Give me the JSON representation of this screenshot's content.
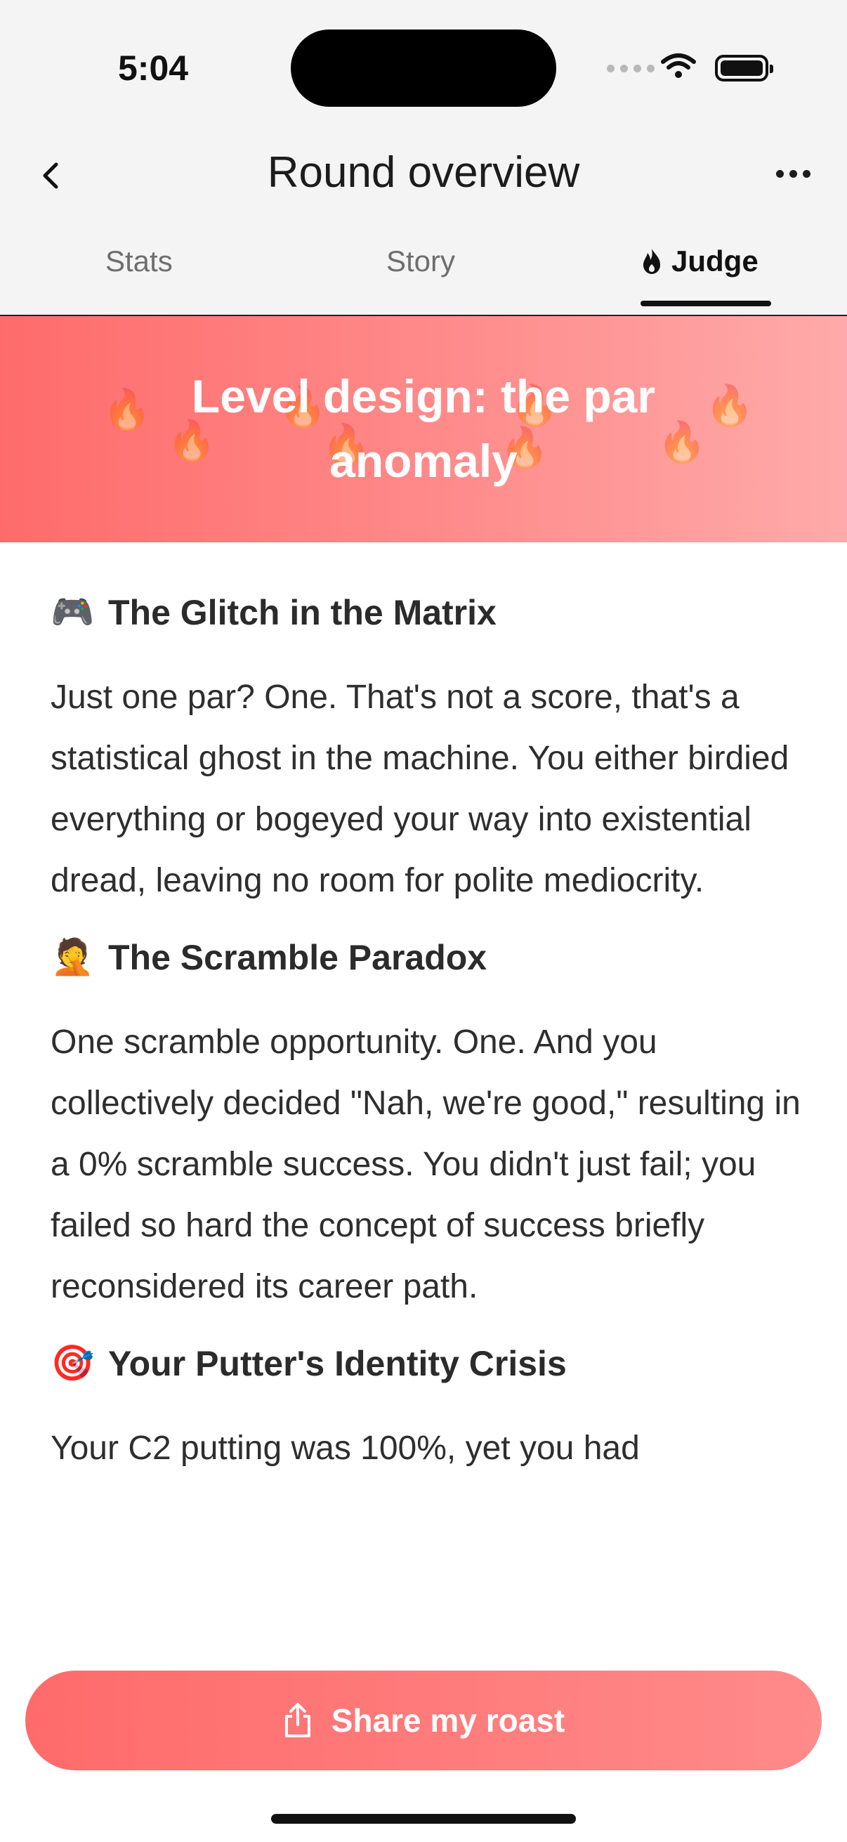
{
  "status_bar": {
    "time": "5:04"
  },
  "header": {
    "title": "Round overview",
    "tabs": [
      {
        "label": "Stats",
        "active": false
      },
      {
        "label": "Story",
        "active": false
      },
      {
        "label": "Judge",
        "active": true,
        "icon": "flame-icon"
      }
    ]
  },
  "banner": {
    "title": "Level design: the par anomaly",
    "colors": {
      "start": "#ff6b6b",
      "end": "#ffaaaa"
    }
  },
  "sections": [
    {
      "emoji": "🎮",
      "title": "The Glitch in the Matrix",
      "body": "Just one par? One. That's not a score, that's a statistical ghost in the machine. You either birdied everything or bogeyed your way into existential dread, leaving no room for polite mediocrity."
    },
    {
      "emoji": "🤦",
      "title": "The Scramble Paradox",
      "body": "One scramble opportunity. One. And you collectively decided \"Nah, we're good,\" resulting in a 0% scramble success. You didn't just fail; you failed so hard the concept of success briefly reconsidered its career path."
    },
    {
      "emoji": "🎯",
      "title": "Your Putter's Identity Crisis",
      "body": "Your C2 putting was 100%, yet you had"
    }
  ],
  "share_button": {
    "label": "Share my roast",
    "icon": "share-icon"
  },
  "colors": {
    "accent": "#ff6b6b"
  }
}
